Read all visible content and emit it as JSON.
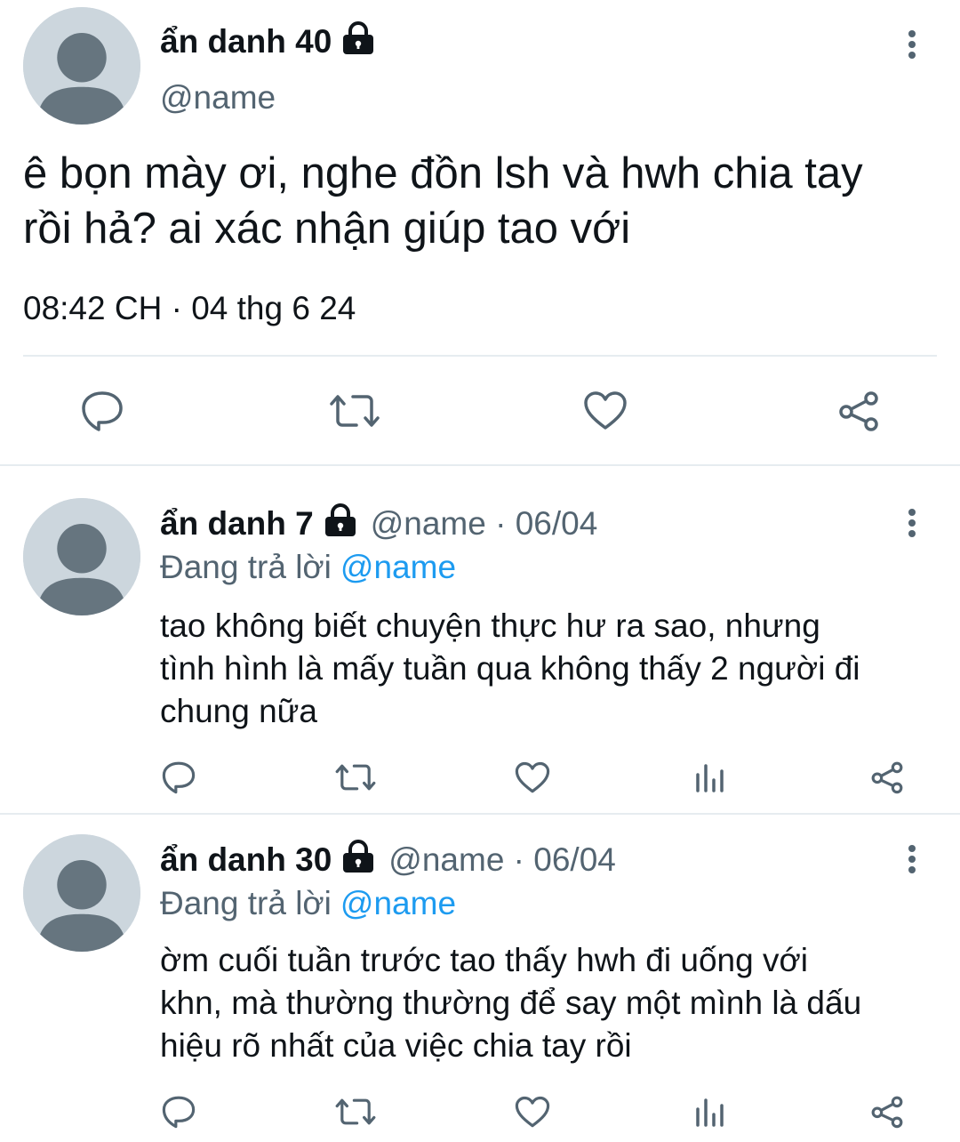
{
  "main_tweet": {
    "display_name": "ẩn danh 40",
    "handle": "@name",
    "text_line1": "ê bọn mày ơi, nghe đồn lsh và hwh chia tay",
    "text_line2": "rồi hả? ai xác nhận giúp tao với",
    "timestamp": "08:42 CH · 04 thg 6 24"
  },
  "replies": [
    {
      "display_name": "ẩn danh 7",
      "handle_date": "@name · 06/04",
      "replying_prefix": "Đang trả lời",
      "replying_handle": "@name",
      "lines": [
        "tao không biết chuyện thực hư ra sao, nhưng",
        "tình hình là mấy tuần qua không thấy 2 người đi",
        "chung nữa"
      ]
    },
    {
      "display_name": "ẩn danh 30",
      "handle_date": "@name · 06/04",
      "replying_prefix": "Đang trả lời",
      "replying_handle": "@name",
      "lines": [
        "ờm cuối tuần trước tao thấy hwh đi uống với",
        "khn, mà thường thường để say một mình là dấu",
        "hiệu rõ nhất của việc chia tay rồi"
      ]
    }
  ],
  "icons": {
    "reply": "speech-bubble-icon",
    "retweet": "retweet-icon",
    "like": "heart-icon",
    "views": "bar-chart-icon",
    "share": "share-icon",
    "more": "more-vertical-icon",
    "lock": "lock-icon",
    "avatar": "default-avatar"
  },
  "colors": {
    "text": "#0f1419",
    "muted": "#536471",
    "link": "#1d9bf0",
    "divider": "#e1e8ed",
    "avatar_bg": "#ccd6dd",
    "avatar_fg": "#66757f"
  }
}
